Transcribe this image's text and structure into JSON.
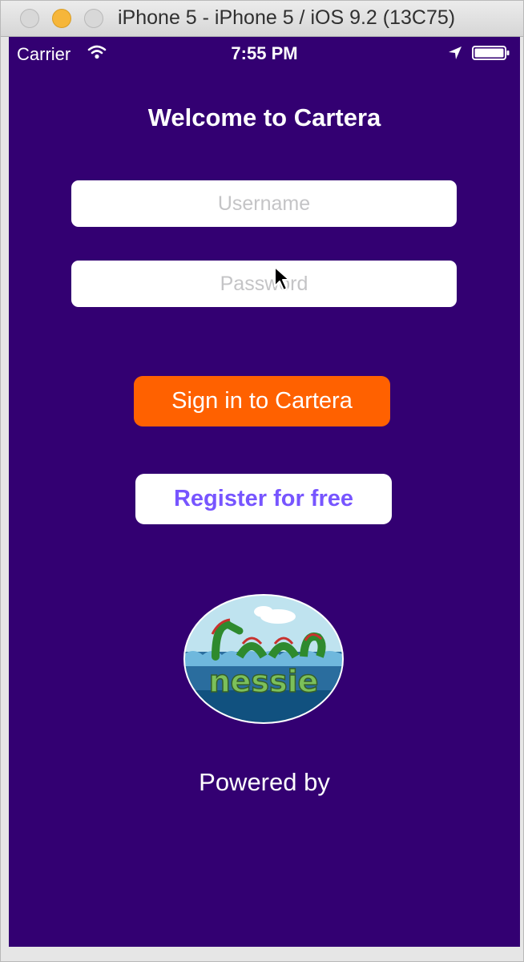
{
  "window": {
    "title": "iPhone 5 - iPhone 5 / iOS 9.2 (13C75)"
  },
  "status_bar": {
    "carrier": "Carrier",
    "time": "7:55 PM"
  },
  "login": {
    "welcome_title": "Welcome to Cartera",
    "username_placeholder": "Username",
    "password_placeholder": "Password",
    "signin_label": "Sign in to Cartera",
    "register_label": "Register for free"
  },
  "footer": {
    "powered_by": "Powered by",
    "logo_text": "nessie"
  },
  "colors": {
    "background": "#330072",
    "signin_button": "#ff6100",
    "register_text": "#7755ff"
  },
  "icons": [
    "wifi-icon",
    "location-arrow-icon",
    "battery-icon",
    "mouse-cursor-icon",
    "nessie-logo"
  ]
}
